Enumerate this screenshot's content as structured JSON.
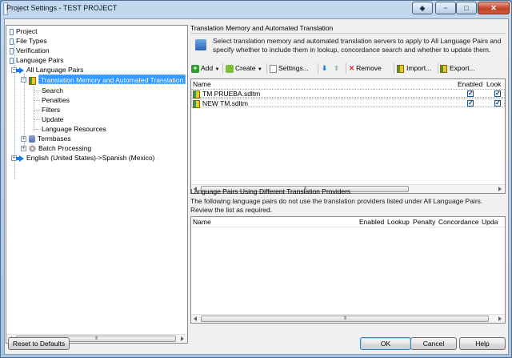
{
  "window": {
    "title": "Project Settings - TEST PROJECT",
    "buttons": {
      "help": "◆",
      "minimize": "−",
      "maximize": "□",
      "close": "✕"
    }
  },
  "tree": {
    "items": [
      {
        "label": "Project",
        "icon": "document-icon",
        "level": 0
      },
      {
        "label": "File Types",
        "icon": "document-icon",
        "level": 0
      },
      {
        "label": "Verification",
        "icon": "document-icon",
        "level": 0
      },
      {
        "label": "Language Pairs",
        "icon": "document-icon",
        "level": 0
      },
      {
        "label": "All Language Pairs",
        "icon": "arrow-icon",
        "level": 1
      },
      {
        "label": "Translation Memory and Automated Translation",
        "icon": "translation-memory-icon",
        "level": 2,
        "selected": true
      },
      {
        "label": "Search",
        "level": 3
      },
      {
        "label": "Penalties",
        "level": 3
      },
      {
        "label": "Filters",
        "level": 3
      },
      {
        "label": "Update",
        "level": 3
      },
      {
        "label": "Language Resources",
        "level": 3
      },
      {
        "label": "Termbases",
        "icon": "database-icon",
        "level": 2
      },
      {
        "label": "Batch Processing",
        "icon": "gear-icon",
        "level": 2
      },
      {
        "label": "English (United States)->Spanish (Mexico)",
        "icon": "arrow-icon",
        "level": 1
      }
    ]
  },
  "main": {
    "section_title": "Translation Memory and Automated Translation",
    "description": "Select translation memory and automated translation servers to apply to All Language Pairs and specify whether to include them in lookup, concordance search and whether to update them.",
    "toolbar": {
      "add": "Add",
      "create": "Create",
      "settings": "Settings...",
      "remove": "Remove",
      "import": "Import...",
      "export": "Export..."
    },
    "tm_grid": {
      "columns": [
        "Name",
        "Enabled",
        "Look"
      ],
      "rows": [
        {
          "name": "TM PRUEBA.sdltm",
          "enabled": "✓",
          "lookup": "✓"
        },
        {
          "name": "NEW TM.sdltm",
          "enabled": "✓",
          "lookup": "✓"
        }
      ]
    },
    "different_title": "Language Pairs Using Different Translation Providers",
    "different_description": "The following language pairs do not use the translation providers listed under All Language Pairs. Review the list as required.",
    "diff_grid": {
      "columns": [
        "Name",
        "Enabled",
        "Lookup",
        "Penalty",
        "Concordance",
        "Upda"
      ]
    }
  },
  "footer": {
    "reset": "Reset to Defaults",
    "ok": "OK",
    "cancel": "Cancel",
    "help": "Help"
  },
  "scroll_grip": "III",
  "colors": {
    "selection": "#3399ff",
    "arrow": "#1f7ae0",
    "remove": "#d42b1e",
    "add": "#2f9a2b"
  }
}
